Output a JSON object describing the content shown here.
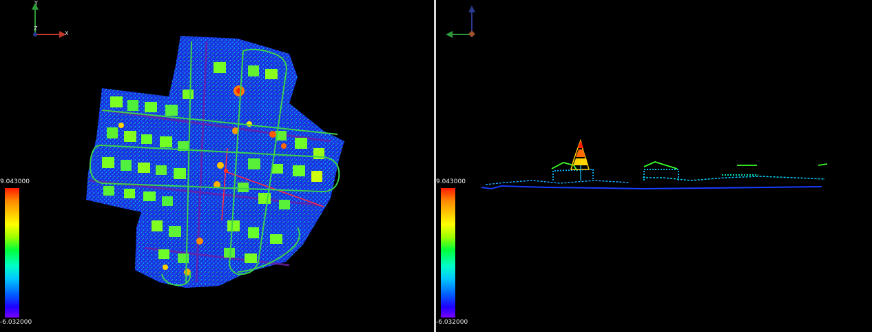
{
  "left_view": {
    "axes": {
      "x": "X",
      "y": "Y",
      "z": "Z"
    },
    "scalar_bar": {
      "max": "9.043000",
      "min": "-6.032000"
    }
  },
  "right_view": {
    "scalar_bar": {
      "max": "9.043000",
      "min": "-6.032000"
    }
  },
  "colors": {
    "background": "#000000",
    "divider": "#d8d8d8",
    "trajectory": "#3cd24a",
    "axis_x": "#c0392b",
    "axis_y": "#2e9b3a",
    "axis_z": "#2a3a8f"
  }
}
